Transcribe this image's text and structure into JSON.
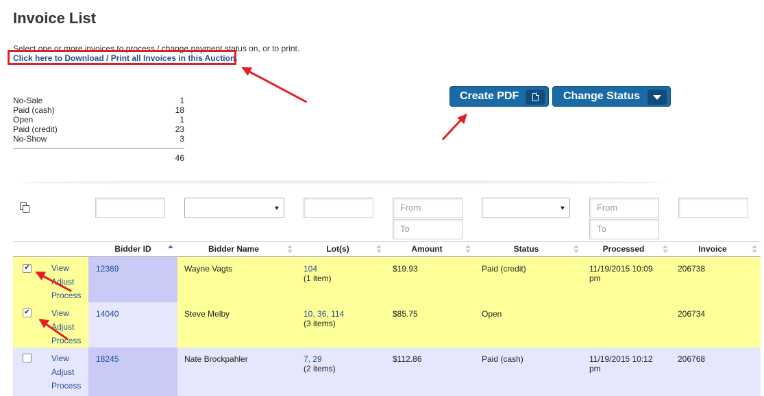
{
  "page_title": "Invoice List",
  "instructions": "Select one or more invoices to process / change payment status on, or to print.",
  "download_link": "Click here to Download / Print all Invoices in this Auction.",
  "summary": {
    "items": [
      {
        "label": "No-Sale",
        "count": "1"
      },
      {
        "label": "Paid (cash)",
        "count": "18"
      },
      {
        "label": "Open",
        "count": "1"
      },
      {
        "label": "Paid (credit)",
        "count": "23"
      },
      {
        "label": "No-Show",
        "count": "3"
      }
    ],
    "total": "46"
  },
  "buttons": {
    "create_pdf": "Create PDF",
    "change_status": "Change Status"
  },
  "filters": {
    "from_placeholder": "From",
    "to_placeholder": "To"
  },
  "columns": [
    "Bidder ID",
    "Bidder Name",
    "Lot(s)",
    "Amount",
    "Status",
    "Processed",
    "Invoice"
  ],
  "action_links": {
    "view": "View",
    "adjust": "Adjust",
    "process": "Process"
  },
  "rows": [
    {
      "checked": true,
      "bidder_id": "12369",
      "bidder_name": "Wayne Vagts",
      "lots": "104",
      "items": "(1 item)",
      "amount": "$19.93",
      "status": "Paid (credit)",
      "processed_line1": "11/19/2015 10:09",
      "processed_line2": "pm",
      "invoice": "206738"
    },
    {
      "checked": true,
      "bidder_id": "14040",
      "bidder_name": "Steve Melby",
      "lots": "10, 36, 114",
      "items": "(3 items)",
      "amount": "$85.75",
      "status": "Open",
      "processed_line1": "",
      "processed_line2": "",
      "invoice": "206734"
    },
    {
      "checked": false,
      "bidder_id": "18245",
      "bidder_name": "Nate Brockpahler",
      "lots": "7, 29",
      "items": "(2 items)",
      "amount": "$112.86",
      "status": "Paid (cash)",
      "processed_line1": "11/19/2015 10:12",
      "processed_line2": "pm",
      "invoice": "206768"
    }
  ],
  "colors": {
    "selected_row": "#ffff99",
    "row_bg": "#e6e6fc",
    "sorted_column": "#cacaf6",
    "sorted_column_light": "#e0e0fa",
    "button": "#1a6aa6",
    "annotation": "#e41f24"
  }
}
